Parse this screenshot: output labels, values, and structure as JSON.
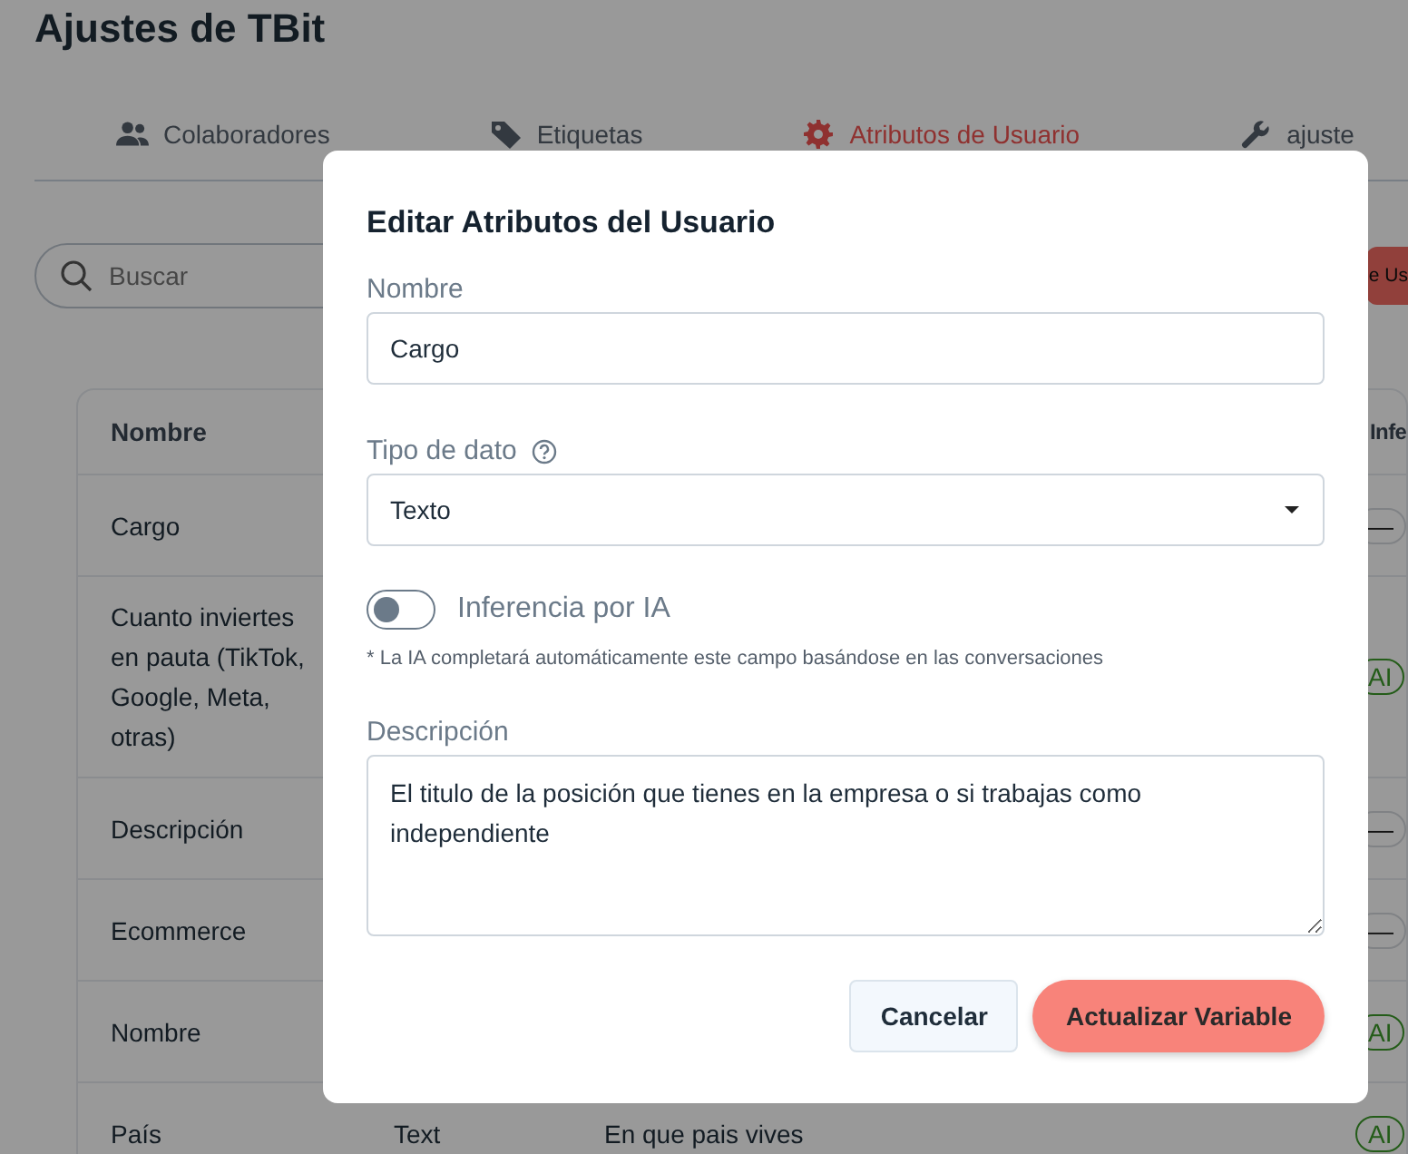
{
  "page": {
    "title": "Ajustes de TBit"
  },
  "tabs": [
    {
      "label": "Colaboradores",
      "selected": false
    },
    {
      "label": "Etiquetas",
      "selected": false
    },
    {
      "label": "Atributos de Usuario",
      "selected": true
    },
    {
      "label": "ajuste",
      "selected": false
    }
  ],
  "search": {
    "placeholder": "Buscar"
  },
  "create_button": {
    "label": "e Us"
  },
  "table": {
    "columns": [
      "Nombre",
      "Infe"
    ],
    "rows": [
      {
        "name": "Cargo",
        "inference": {
          "kind": "none",
          "label": "—"
        }
      },
      {
        "name": "Cuanto inviertes en pauta (TikTok, Google, Meta, otras)",
        "inference": {
          "kind": "ai",
          "label": "AI"
        }
      },
      {
        "name": "Descripción",
        "inference": {
          "kind": "none",
          "label": "—"
        }
      },
      {
        "name": "Ecommerce",
        "inference": {
          "kind": "none",
          "label": "—"
        }
      },
      {
        "name": "Nombre",
        "inference": {
          "kind": "ai",
          "label": "AI"
        }
      },
      {
        "name": "País",
        "column_2": "Text",
        "column_3": "En que pais vives",
        "inference": {
          "kind": "ai",
          "label": "AI"
        }
      }
    ]
  },
  "modal": {
    "title": "Editar Atributos del Usuario",
    "name_field": {
      "label": "Nombre",
      "value": "Cargo"
    },
    "type_field": {
      "label": "Tipo de dato",
      "value": "Texto"
    },
    "ai_toggle": {
      "label": "Inferencia por IA",
      "on": false,
      "note": "* La IA completará automáticamente este campo basándose en las conversaciones"
    },
    "description_field": {
      "label": "Descripción",
      "value": "El titulo de la posición que tienes en la empresa o si trabajas como independiente"
    },
    "buttons": [
      {
        "label": "Cancelar",
        "kind": "secondary"
      },
      {
        "label": "Actualizar Variable",
        "kind": "primary"
      }
    ]
  }
}
